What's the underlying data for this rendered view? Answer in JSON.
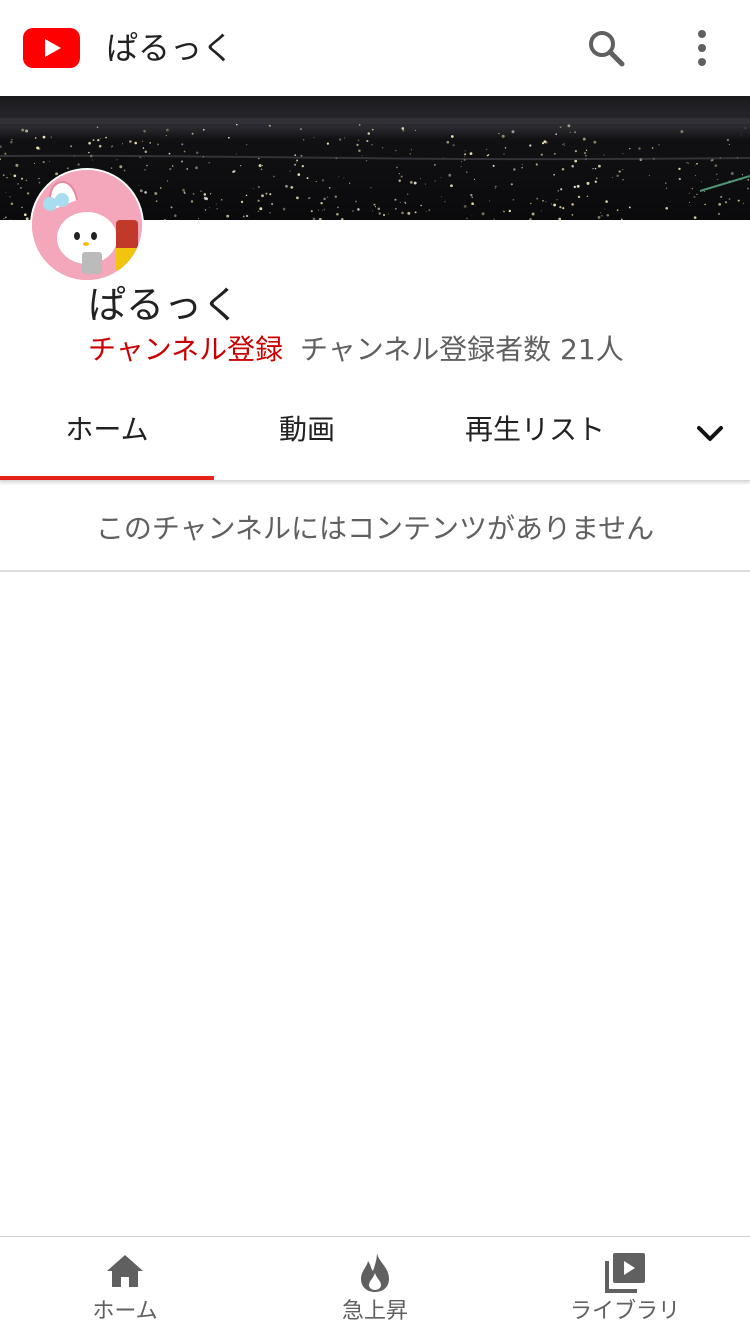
{
  "header": {
    "title": "ぱるっく",
    "logo_icon": "youtube-logo-icon",
    "search_icon": "search-icon",
    "more_icon": "more-vert-icon",
    "brand_color": "#ff0000"
  },
  "channel": {
    "name": "ぱるっく",
    "subscribe_label": "チャンネル登録",
    "subscriber_count": "チャンネル登録者数 21人",
    "subscribe_color": "#cc0000"
  },
  "tabs": {
    "items": [
      {
        "label": "ホーム",
        "active": true
      },
      {
        "label": "動画",
        "active": false
      },
      {
        "label": "再生リスト",
        "active": false
      }
    ],
    "more_icon": "chevron-down-icon",
    "active_color": "#e62117"
  },
  "content": {
    "empty_message": "このチャンネルにはコンテンツがありません"
  },
  "bottom_nav": {
    "items": [
      {
        "label": "ホーム",
        "icon": "home-icon"
      },
      {
        "label": "急上昇",
        "icon": "trending-icon"
      },
      {
        "label": "ライブラリ",
        "icon": "library-icon"
      }
    ]
  }
}
